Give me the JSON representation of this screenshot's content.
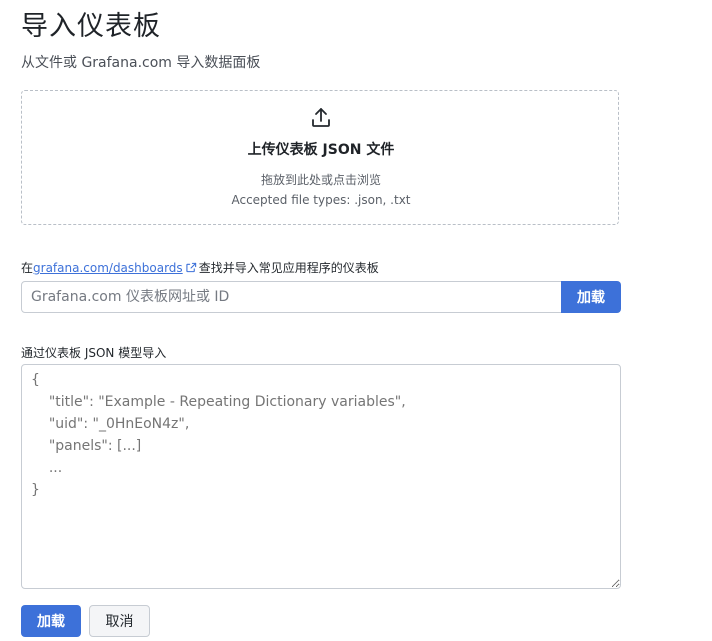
{
  "page": {
    "title": "导入仪表板",
    "subtitle": "从文件或 Grafana.com 导入数据面板"
  },
  "upload": {
    "icon": "upload-icon",
    "title": "上传仪表板 JSON 文件",
    "hint": "拖放到此处或点击浏览",
    "accepted_types": "Accepted file types: .json, .txt"
  },
  "grafana_com": {
    "label_prefix": "在",
    "link_text": "grafana.com/dashboards",
    "link_icon": "external-link-icon",
    "label_suffix": "查找并导入常见应用程序的仪表板",
    "input_value": "",
    "input_placeholder": "Grafana.com 仪表板网址或 ID",
    "load_label": "加载"
  },
  "json_model": {
    "label": "通过仪表板 JSON 模型导入",
    "placeholder": "{\n    \"title\": \"Example - Repeating Dictionary variables\",\n    \"uid\": \"_0HnEoN4z\",\n    \"panels\": [...]\n    ...\n}",
    "value": ""
  },
  "actions": {
    "load_label": "加载",
    "cancel_label": "取消"
  },
  "colors": {
    "primary": "#3d71d9",
    "link": "#3d71d9",
    "border": "#c7ccd3"
  }
}
